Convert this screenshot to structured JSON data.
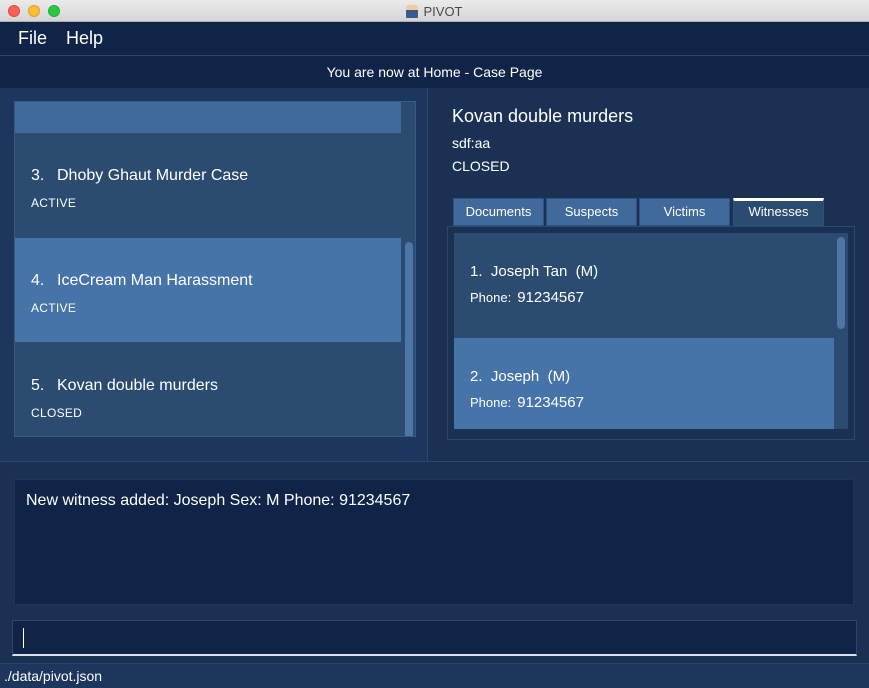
{
  "window": {
    "title": "PIVOT",
    "app_icon": "pivot-app-icon"
  },
  "menu": {
    "file": "File",
    "help": "Help"
  },
  "location": {
    "text": "You are now at Home - Case Page"
  },
  "cases": [
    {
      "index": "3.",
      "title": "Dhoby Ghaut Murder Case",
      "status": "ACTIVE"
    },
    {
      "index": "4.",
      "title": "IceCream Man Harassment",
      "status": "ACTIVE"
    },
    {
      "index": "5.",
      "title": "Kovan double murders",
      "status": "CLOSED"
    }
  ],
  "detail": {
    "name": "Kovan double murders",
    "description": "sdf:aa",
    "status": "CLOSED",
    "tabs": [
      "Documents",
      "Suspects",
      "Victims",
      "Witnesses"
    ],
    "active_tab": "Witnesses",
    "witnesses": [
      {
        "index": "1.",
        "name": "Joseph Tan",
        "sex": "(M)",
        "phone_label": "Phone:",
        "phone": "91234567"
      },
      {
        "index": "2.",
        "name": "Joseph",
        "sex": "(M)",
        "phone_label": "Phone:",
        "phone": "91234567"
      }
    ]
  },
  "result": {
    "text": "New witness added: Joseph Sex: M Phone: 91234567"
  },
  "command": {
    "value": ""
  },
  "status_bar": {
    "path": "./data/pivot.json"
  },
  "colors": {
    "menu_bg": "#0f2447",
    "panel_bg": "#1b3154",
    "list_bg": "#2b4c70",
    "selected_bg": "#4673a8"
  }
}
